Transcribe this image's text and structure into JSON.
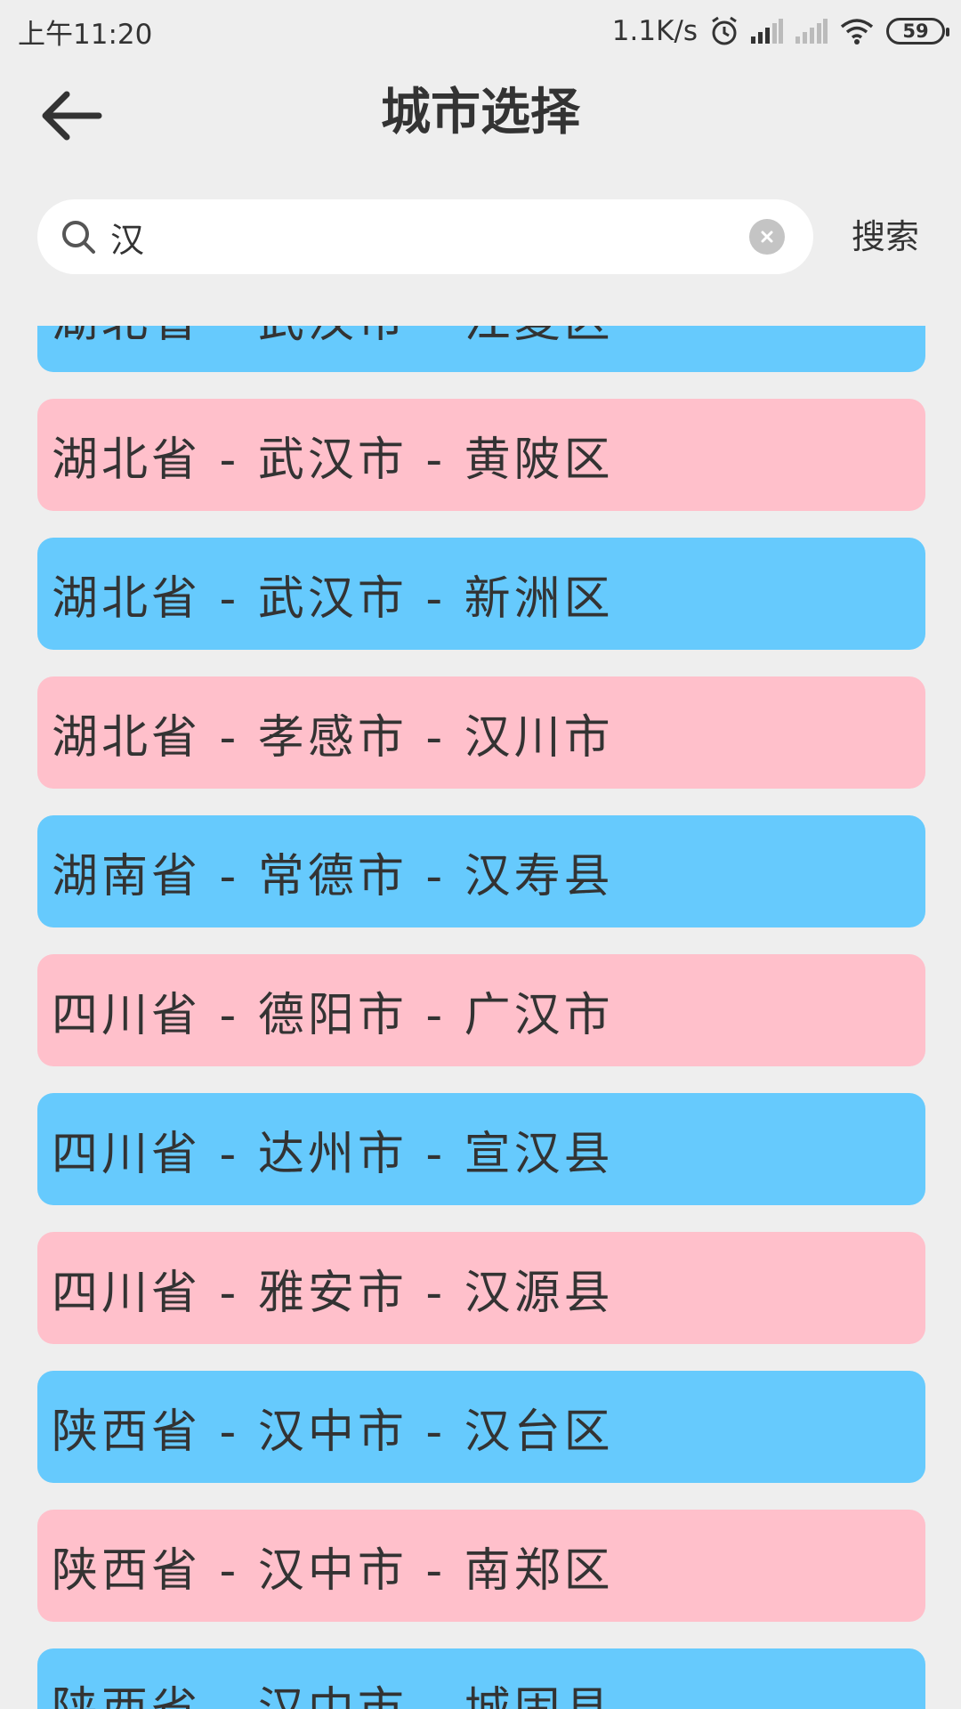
{
  "status_bar": {
    "time": "上午11:20",
    "net_speed": "1.1K/s",
    "battery": "59",
    "icons": [
      "alarm-icon",
      "signal-icon",
      "signal-icon",
      "wifi-icon",
      "battery-icon"
    ]
  },
  "header": {
    "title": "城市选择",
    "back_icon": "arrow-left-icon"
  },
  "search": {
    "value": "汉",
    "button_label": "搜索"
  },
  "colors": {
    "blue": "#66cafd",
    "pink": "#ffc0cb",
    "background": "#eeeeee"
  },
  "cities": [
    {
      "label": "湖北省 - 武汉市 - 江夏区",
      "color": "blue"
    },
    {
      "label": "湖北省 - 武汉市 - 黄陂区",
      "color": "pink"
    },
    {
      "label": "湖北省 - 武汉市 - 新洲区",
      "color": "blue"
    },
    {
      "label": "湖北省 - 孝感市 - 汉川市",
      "color": "pink"
    },
    {
      "label": "湖南省 - 常德市 - 汉寿县",
      "color": "blue"
    },
    {
      "label": "四川省 - 德阳市 - 广汉市",
      "color": "pink"
    },
    {
      "label": "四川省 - 达州市 - 宣汉县",
      "color": "blue"
    },
    {
      "label": "四川省 - 雅安市 - 汉源县",
      "color": "pink"
    },
    {
      "label": "陕西省 - 汉中市 - 汉台区",
      "color": "blue"
    },
    {
      "label": "陕西省 - 汉中市 - 南郑区",
      "color": "pink"
    },
    {
      "label": "陕西省 - 汉中市 - 城固县",
      "color": "blue"
    }
  ]
}
